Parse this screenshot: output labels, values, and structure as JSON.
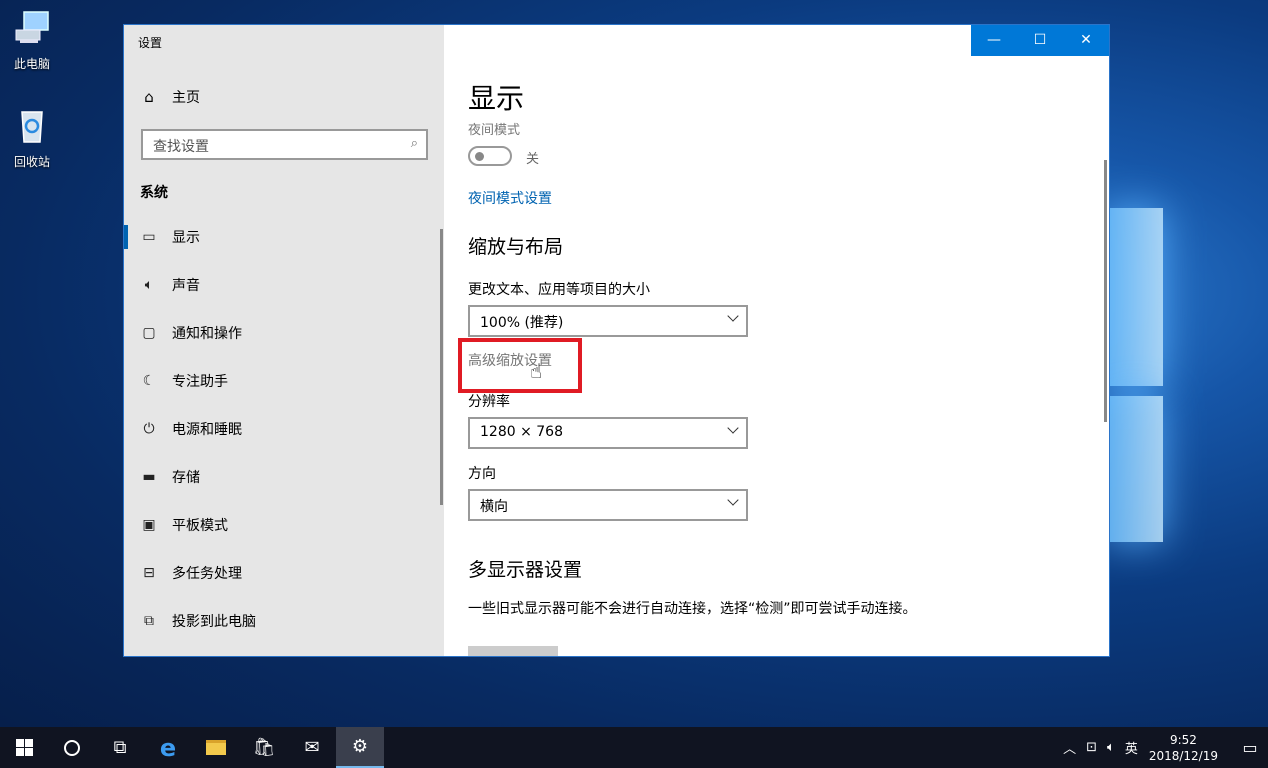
{
  "desktop": {
    "icons": [
      {
        "label": "此电脑",
        "icon": "computer-icon"
      },
      {
        "label": "回收站",
        "icon": "recycle-bin-icon"
      }
    ]
  },
  "window": {
    "title": "设置",
    "controls": {
      "minimize": "—",
      "maximize": "☐",
      "close": "✕"
    }
  },
  "sidebar": {
    "home_label": "主页",
    "search_placeholder": "查找设置",
    "section": "系统",
    "items": [
      {
        "label": "显示",
        "icon": "monitor-icon",
        "active": true
      },
      {
        "label": "声音",
        "icon": "speaker-icon"
      },
      {
        "label": "通知和操作",
        "icon": "message-icon"
      },
      {
        "label": "专注助手",
        "icon": "moon-icon"
      },
      {
        "label": "电源和睡眠",
        "icon": "power-icon"
      },
      {
        "label": "存储",
        "icon": "drive-icon"
      },
      {
        "label": "平板模式",
        "icon": "tablet-icon"
      },
      {
        "label": "多任务处理",
        "icon": "multitask-icon"
      },
      {
        "label": "投影到此电脑",
        "icon": "project-icon"
      }
    ]
  },
  "main": {
    "title": "显示",
    "night_mode_label": "夜间模式",
    "night_mode_state": "关",
    "night_mode_link": "夜间模式设置",
    "scale_heading": "缩放与布局",
    "scale_label": "更改文本、应用等项目的大小",
    "scale_value": "100% (推荐)",
    "advanced_scaling_link": "高级缩放设置",
    "resolution_label": "分辨率",
    "resolution_value": "1280 × 768",
    "orientation_label": "方向",
    "orientation_value": "横向",
    "multi_display_heading": "多显示器设置",
    "multi_display_desc": "一些旧式显示器可能不会进行自动连接，选择“检测”即可尝试手动连接。"
  },
  "taskbar": {
    "tray": {
      "ime": "英",
      "time": "9:52",
      "date": "2018/12/19"
    }
  },
  "colors": {
    "accent": "#0078d7",
    "link": "#0063b1",
    "highlight_box": "#e01b24"
  }
}
